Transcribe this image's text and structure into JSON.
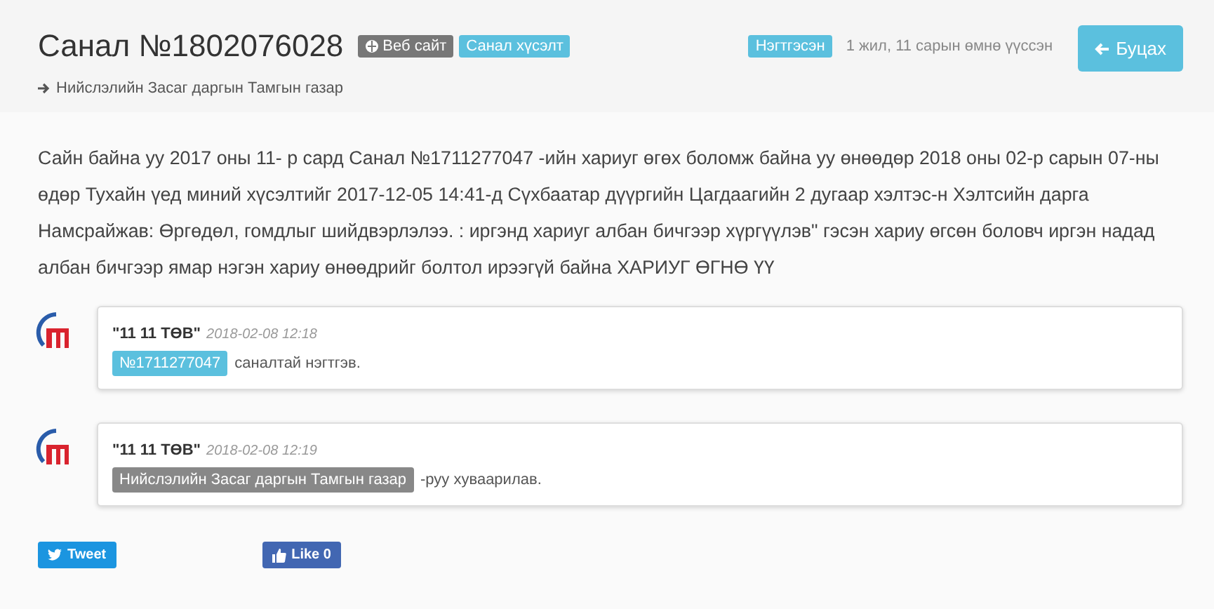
{
  "title": "Санал №1802076028",
  "tags": [
    {
      "kind": "link",
      "label": "Веб сайт"
    },
    {
      "kind": "category",
      "label": "Санал хүсэлт"
    }
  ],
  "organization": "Нийслэлийн Засаг даргын Тамгын газар",
  "status": "Нэгтгэсэн",
  "time_ago": "1 жил, 11 сарын өмнө үүссэн",
  "back_button": "Буцах",
  "body": "Сайн байна уу 2017 оны 11- р сард Санал №1711277047 -ийн хариуг өгөх боломж байна уу өнөөдөр 2018 оны 02-р сарын 07-ны өдөр Тухайн үед миний хүсэлтийг 2017-12-05 14:41-д Сүхбаатар дүүргийн Цагдаагийн 2 дугаар хэлтэс-н Хэлтсийн дарга Намсрайжав: Өргөдөл, гомдлыг шийдвэрлэлээ. : иргэнд хариуг албан бичгээр хүргүүлэв\" гэсэн хариу өгсөн боловч иргэн надад албан бичгээр ямар нэгэн хариу өнөөдрийг болтол ирээгүй байна ХАРИУГ ӨГНӨ ҮҮ",
  "comments": [
    {
      "author": "\"11 11 ТӨВ\"",
      "date": "2018-02-08 12:18",
      "tag": {
        "kind": "suggestion",
        "label": "№1711277047"
      },
      "text": "саналтай нэгтгэв."
    },
    {
      "author": "\"11 11 ТӨВ\"",
      "date": "2018-02-08 12:19",
      "tag": {
        "kind": "organization",
        "label": "Нийслэлийн Засаг даргын Тамгын газар"
      },
      "text": "-руу хуваарилав."
    }
  ],
  "share": {
    "tweet": "Tweet",
    "like": "Like 0"
  }
}
